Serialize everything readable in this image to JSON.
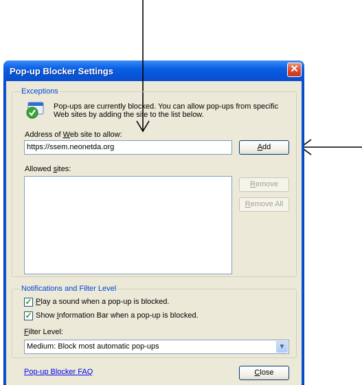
{
  "window": {
    "title": "Pop-up Blocker Settings",
    "close_glyph": "✕"
  },
  "exceptions": {
    "legend": "Exceptions",
    "info_line1": "Pop-ups are currently blocked.  You can allow pop-ups from specific",
    "info_line2": "Web sites by adding the site to the list below.",
    "address_label_pre": "Address of ",
    "address_label_key": "W",
    "address_label_post": "eb site to allow:",
    "address_value": "https://ssem.neonetda.org",
    "add_key": "A",
    "add_rest": "dd",
    "allowed_label_pre": "Allowed ",
    "allowed_label_key": "s",
    "allowed_label_post": "ites:",
    "allowed_sites": [],
    "remove_key": "R",
    "remove_rest": "emove",
    "remove_all_key": "R",
    "remove_all_rest": "emove All"
  },
  "notifications": {
    "legend": "Notifications and Filter Level",
    "play_sound_key": "P",
    "play_sound_rest": "lay a sound when a pop-up is blocked.",
    "play_sound_checked": true,
    "info_bar_pre": "Show ",
    "info_bar_key": "I",
    "info_bar_post": "nformation Bar when a pop-up is blocked.",
    "info_bar_checked": true,
    "filter_label_key": "F",
    "filter_label_rest": "ilter Level:",
    "filter_value": "Medium: Block most automatic pop-ups"
  },
  "footer": {
    "faq_link": "Pop-up Blocker FAQ",
    "close_key": "C",
    "close_rest": "lose"
  },
  "icons": {
    "check_glyph": "✓",
    "dropdown_glyph": "▼"
  }
}
